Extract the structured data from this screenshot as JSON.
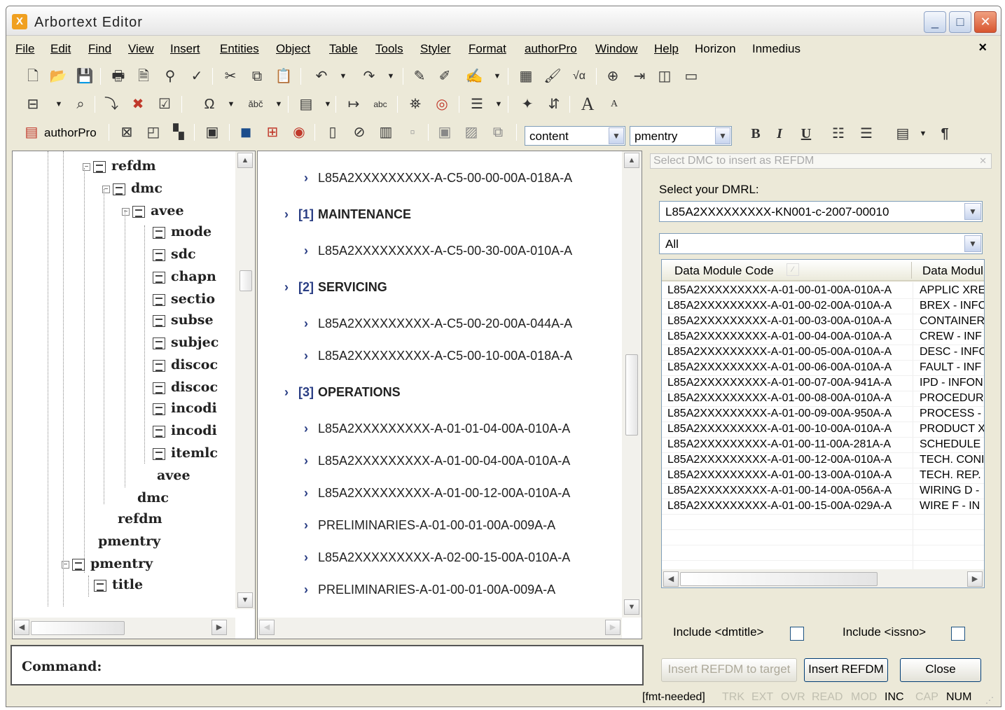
{
  "window": {
    "title": "Arbortext Editor",
    "logo": "X"
  },
  "menu": [
    "File",
    "Edit",
    "Find",
    "View",
    "Insert",
    "Entities",
    "Object",
    "Table",
    "Tools",
    "Styler",
    "Format",
    "authorPro",
    "Window",
    "Help",
    "Horizon",
    "Inmedius"
  ],
  "menu_close": "×",
  "toolbar": {
    "authorpro_label": "authorPro",
    "element_combo": "content",
    "style_combo": "pmentry",
    "bold": "B",
    "italic": "I",
    "underline": "U",
    "pilcrow": "¶",
    "font_grow": "A",
    "font_shrink": "A"
  },
  "tree": [
    {
      "label": "refdm",
      "expander": "−"
    },
    {
      "label": "dmc",
      "expander": "−"
    },
    {
      "label": "avee",
      "expander": "−"
    },
    {
      "label": "mode"
    },
    {
      "label": "sdc"
    },
    {
      "label": "chapn"
    },
    {
      "label": "sectio"
    },
    {
      "label": "subse"
    },
    {
      "label": "subjec"
    },
    {
      "label": "discoc"
    },
    {
      "label": "discoc"
    },
    {
      "label": "incodi"
    },
    {
      "label": "incodi"
    },
    {
      "label": "itemlc"
    },
    {
      "label": "avee"
    },
    {
      "label": "dmc"
    },
    {
      "label": "refdm"
    },
    {
      "label": "pmentry"
    },
    {
      "label": "pmentry",
      "expander": "−"
    },
    {
      "label": "title"
    }
  ],
  "document": [
    {
      "text": "L85A2XXXXXXXXX-A-C5-00-00-00A-018A-A"
    },
    {
      "num": "[1]",
      "text": "MAINTENANCE"
    },
    {
      "text": "L85A2XXXXXXXXX-A-C5-00-30-00A-010A-A"
    },
    {
      "num": "[2]",
      "text": "SERVICING"
    },
    {
      "text": "L85A2XXXXXXXXX-A-C5-00-20-00A-044A-A"
    },
    {
      "text": "L85A2XXXXXXXXX-A-C5-00-10-00A-018A-A"
    },
    {
      "num": "[3]",
      "text": "OPERATIONS"
    },
    {
      "text": "L85A2XXXXXXXXX-A-01-01-04-00A-010A-A"
    },
    {
      "text": "L85A2XXXXXXXXX-A-01-00-04-00A-010A-A"
    },
    {
      "text": "L85A2XXXXXXXXX-A-01-00-12-00A-010A-A"
    },
    {
      "text": "PRELIMINARIES-A-01-00-01-00A-009A-A"
    },
    {
      "text": "L85A2XXXXXXXXX-A-02-00-15-00A-010A-A"
    },
    {
      "text": "PRELIMINARIES-A-01-00-01-00A-009A-A"
    }
  ],
  "refdm_panel": {
    "search_placeholder": "Select DMC to insert as REFDM",
    "dmrl_label": "Select your DMRL:",
    "dmrl_value": "L85A2XXXXXXXXX-KN001-c-2007-00010",
    "filter_value": "All",
    "columns": [
      "Data Module Code",
      "Data Modul"
    ],
    "rows": [
      [
        "L85A2XXXXXXXXX-A-01-00-01-00A-010A-A",
        "APPLIC XRE"
      ],
      [
        "L85A2XXXXXXXXX-A-01-00-02-00A-010A-A",
        "BREX - INFC"
      ],
      [
        "L85A2XXXXXXXXX-A-01-00-03-00A-010A-A",
        "CONTAINER"
      ],
      [
        "L85A2XXXXXXXXX-A-01-00-04-00A-010A-A",
        "CREW - INF"
      ],
      [
        "L85A2XXXXXXXXX-A-01-00-05-00A-010A-A",
        "DESC - INFC"
      ],
      [
        "L85A2XXXXXXXXX-A-01-00-06-00A-010A-A",
        "FAULT - INF"
      ],
      [
        "L85A2XXXXXXXXX-A-01-00-07-00A-941A-A",
        "IPD - INFON"
      ],
      [
        "L85A2XXXXXXXXX-A-01-00-08-00A-010A-A",
        "PROCEDUR."
      ],
      [
        "L85A2XXXXXXXXX-A-01-00-09-00A-950A-A",
        "PROCESS -"
      ],
      [
        "L85A2XXXXXXXXX-A-01-00-10-00A-010A-A",
        "PRODUCT X"
      ],
      [
        "L85A2XXXXXXXXX-A-01-00-11-00A-281A-A",
        "SCHEDULE -"
      ],
      [
        "L85A2XXXXXXXXX-A-01-00-12-00A-010A-A",
        "TECH. CONI"
      ],
      [
        "L85A2XXXXXXXXX-A-01-00-13-00A-010A-A",
        "TECH. REP."
      ],
      [
        "L85A2XXXXXXXXX-A-01-00-14-00A-056A-A",
        "WIRING D -"
      ],
      [
        "L85A2XXXXXXXXX-A-01-00-15-00A-029A-A",
        "WIRE F - IN"
      ]
    ],
    "include_dmtitle": "Include <dmtitle>",
    "include_issno": "Include <issno>",
    "btn_insert_target": "Insert REFDM to target",
    "btn_insert": "Insert REFDM",
    "btn_close": "Close"
  },
  "command_label": "Command:",
  "status": {
    "fmt": "[fmt-needed]",
    "indicators": [
      {
        "label": "TRK",
        "active": false
      },
      {
        "label": "EXT",
        "active": false
      },
      {
        "label": "OVR",
        "active": false
      },
      {
        "label": "READ",
        "active": false
      },
      {
        "label": "MOD",
        "active": false
      },
      {
        "label": "INC",
        "active": true
      },
      {
        "label": "CAP",
        "active": false
      },
      {
        "label": "NUM",
        "active": true
      }
    ]
  }
}
